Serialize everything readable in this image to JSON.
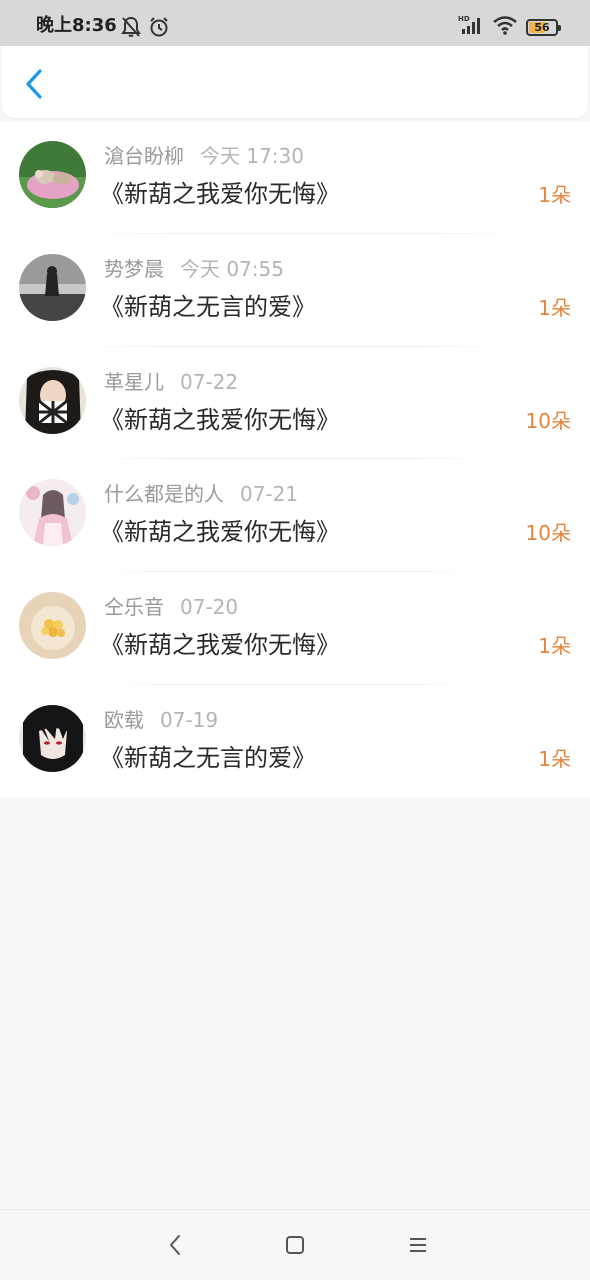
{
  "status_bar": {
    "time": "晚上8:36",
    "battery": "56",
    "icons": [
      "bell-off-icon",
      "alarm-icon",
      "hd-signal-icon",
      "wifi-icon",
      "battery-icon"
    ]
  },
  "header": {
    "back_icon": "chevron-left-icon"
  },
  "colors": {
    "accent": "#1a9be6",
    "count": "#e6843c",
    "name": "#9a9a9a",
    "title": "#2a2a2a"
  },
  "gifts": [
    {
      "name": "滄台盼柳",
      "time": "今天 17:30",
      "title": "《新葫之我爱你无悔》",
      "count": "1朵"
    },
    {
      "name": "势梦晨",
      "time": "今天 07:55",
      "title": "《新葫之无言的爱》",
      "count": "1朵"
    },
    {
      "name": "革星儿",
      "time": "07-22",
      "title": "《新葫之我爱你无悔》",
      "count": "10朵"
    },
    {
      "name": "什么都是的人",
      "time": "07-21",
      "title": "《新葫之我爱你无悔》",
      "count": "10朵"
    },
    {
      "name": "仝乐音",
      "time": "07-20",
      "title": "《新葫之我爱你无悔》",
      "count": "1朵"
    },
    {
      "name": "欧载",
      "time": "07-19",
      "title": "《新葫之无言的爱》",
      "count": "1朵"
    }
  ],
  "nav_bar": {
    "icons": [
      "back-nav-icon",
      "home-nav-icon",
      "menu-nav-icon"
    ]
  }
}
